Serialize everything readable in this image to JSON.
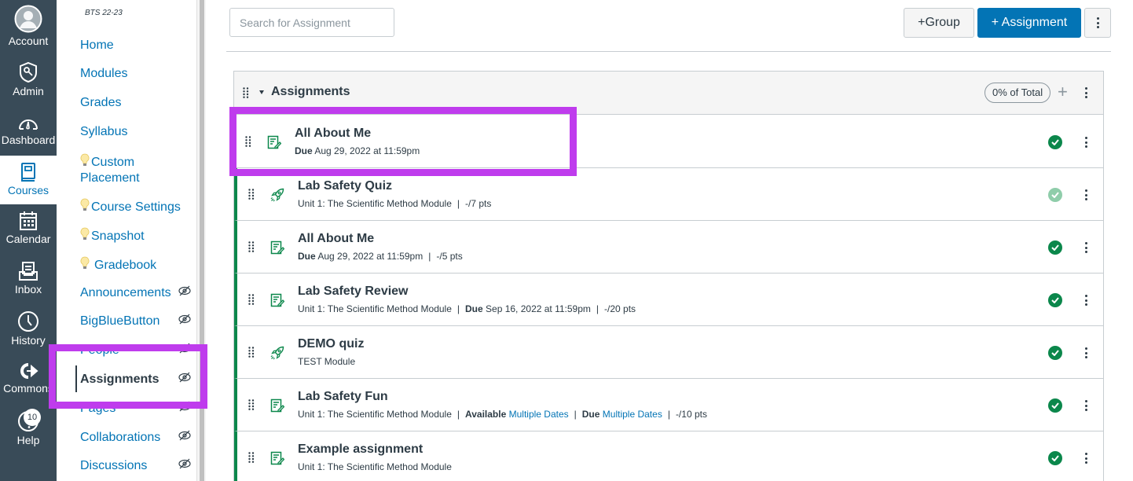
{
  "global_nav": {
    "items": [
      {
        "label": "Account",
        "icon": "avatar-icon"
      },
      {
        "label": "Admin",
        "icon": "admin-shield-icon"
      },
      {
        "label": "Dashboard",
        "icon": "dashboard-gauge-icon"
      },
      {
        "label": "Courses",
        "icon": "courses-book-icon",
        "active": true
      },
      {
        "label": "Calendar",
        "icon": "calendar-icon"
      },
      {
        "label": "Inbox",
        "icon": "inbox-icon"
      },
      {
        "label": "History",
        "icon": "clock-icon"
      },
      {
        "label": "Commons",
        "icon": "commons-arrow-icon"
      },
      {
        "label": "Help",
        "icon": "help-icon",
        "badge": "10"
      }
    ]
  },
  "course_nav": {
    "course_code": "BTS 22-23",
    "items": [
      {
        "label": "Home"
      },
      {
        "label": "Modules"
      },
      {
        "label": "Grades"
      },
      {
        "label": "Syllabus"
      },
      {
        "label": "Custom",
        "label2": "Placement",
        "lti": true
      },
      {
        "label": "Course Settings",
        "lti": true
      },
      {
        "label": "Snapshot",
        "lti": true
      },
      {
        "label": "Gradebook",
        "lti": true
      },
      {
        "label": "Announcements",
        "hidden": true
      },
      {
        "label": "BigBlueButton",
        "hidden": true
      },
      {
        "label": "People",
        "hidden": true
      },
      {
        "label": "Assignments",
        "hidden": true,
        "active": true
      },
      {
        "label": "Pages",
        "hidden": true
      },
      {
        "label": "Collaborations",
        "hidden": true
      },
      {
        "label": "Discussions",
        "hidden": true
      }
    ]
  },
  "toolbar": {
    "search_placeholder": "Search for Assignment",
    "search_value": "",
    "group_button": "+Group",
    "assignment_button": "+ Assignment"
  },
  "group": {
    "title": "Assignments",
    "weight": "0% of Total",
    "assignments": [
      {
        "title": "All About Me",
        "type": "assignment",
        "meta": [
          {
            "bold": "Due",
            "text": " Aug 29, 2022 at 11:59pm"
          }
        ],
        "published": true,
        "published_light": false,
        "highlighted": true
      },
      {
        "title": "Lab Safety Quiz",
        "type": "quiz",
        "meta": [
          {
            "text": "Unit 1: The Scientific Method Module"
          },
          {
            "text": "-/7 pts"
          }
        ],
        "published": true,
        "published_light": true
      },
      {
        "title": "All About Me",
        "type": "assignment",
        "meta": [
          {
            "bold": "Due",
            "text": " Aug 29, 2022 at 11:59pm"
          },
          {
            "text": "-/5 pts"
          }
        ],
        "published": true
      },
      {
        "title": "Lab Safety Review",
        "type": "assignment",
        "meta": [
          {
            "text": "Unit 1: The Scientific Method Module"
          },
          {
            "bold": "Due",
            "text": " Sep 16, 2022 at 11:59pm"
          },
          {
            "text": "-/20 pts"
          }
        ],
        "published": true
      },
      {
        "title": "DEMO quiz",
        "type": "quiz",
        "meta": [
          {
            "text": "TEST Module"
          }
        ],
        "published": true
      },
      {
        "title": "Lab Safety Fun",
        "type": "assignment",
        "meta": [
          {
            "text": "Unit 1: The Scientific Method Module"
          },
          {
            "bold": "Available",
            "link": "Multiple Dates"
          },
          {
            "bold": "Due",
            "link": "Multiple Dates"
          },
          {
            "text": "-/10 pts"
          }
        ],
        "published": true
      },
      {
        "title": "Example assignment",
        "type": "assignment",
        "meta": [
          {
            "text": "Unit 1: The Scientific Method Module"
          }
        ],
        "published": true
      }
    ]
  },
  "colors": {
    "brand_blue": "#0374b5",
    "nav_bg": "#394b58",
    "published_green": "#0b874b",
    "highlight_purple": "#bf3ced"
  }
}
